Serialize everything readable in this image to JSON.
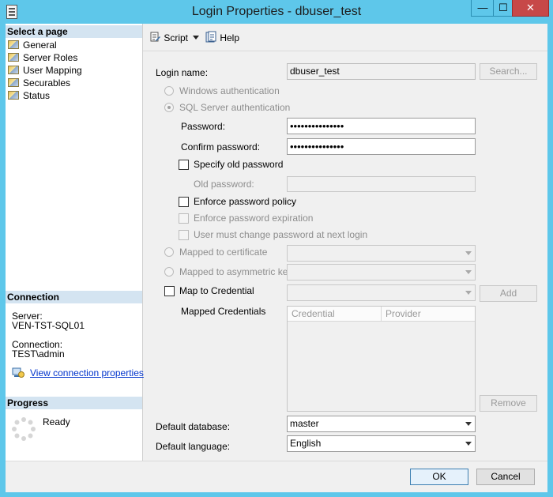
{
  "window": {
    "title": "Login Properties - dbuser_test",
    "minimize_glyph": "—",
    "maximize_glyph": "☐",
    "close_glyph": "✕"
  },
  "left_panel": {
    "select_page_header": "Select a page",
    "pages": [
      {
        "label": "General",
        "icon": "page-icon"
      },
      {
        "label": "Server Roles",
        "icon": "page-icon"
      },
      {
        "label": "User Mapping",
        "icon": "page-icon"
      },
      {
        "label": "Securables",
        "icon": "page-icon"
      },
      {
        "label": "Status",
        "icon": "page-icon"
      }
    ],
    "connection_header": "Connection",
    "server_label": "Server:",
    "server_value": "VEN-TST-SQL01",
    "connection_label": "Connection:",
    "connection_value": "TEST\\admin",
    "view_connection_link": "View connection properties",
    "progress_header": "Progress",
    "progress_status": "Ready"
  },
  "toolbar": {
    "script_label": "Script",
    "help_label": "Help"
  },
  "form": {
    "login_name_label": "Login name:",
    "login_name_value": "dbuser_test",
    "search_button": "Search...",
    "windows_auth_label": "Windows authentication",
    "sql_auth_label": "SQL Server authentication",
    "password_label": "Password:",
    "password_value": "•••••••••••••••",
    "confirm_password_label": "Confirm password:",
    "confirm_password_value": "•••••••••••••••",
    "specify_old_password_label": "Specify old password",
    "old_password_label": "Old password:",
    "enforce_policy_label": "Enforce password policy",
    "enforce_expiration_label": "Enforce password expiration",
    "must_change_label": "User must change password at next login",
    "mapped_cert_label": "Mapped to certificate",
    "mapped_asym_label": "Mapped to asymmetric key",
    "map_credential_label": "Map to Credential",
    "add_button": "Add",
    "mapped_credentials_label": "Mapped Credentials",
    "credentials_columns": [
      "Credential",
      "Provider"
    ],
    "remove_button": "Remove",
    "default_database_label": "Default database:",
    "default_database_value": "master",
    "default_language_label": "Default language:",
    "default_language_value": "English"
  },
  "footer": {
    "ok_button": "OK",
    "cancel_button": "Cancel"
  },
  "colors": {
    "title_bar": "#5ec7ea",
    "section_header": "#d4e4f1",
    "link": "#0033cc",
    "close_button": "#c74848"
  }
}
